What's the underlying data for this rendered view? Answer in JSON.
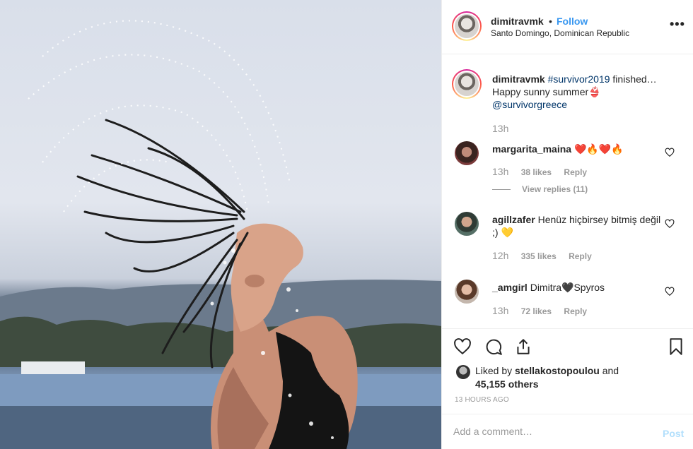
{
  "post": {
    "username": "dimitravmk",
    "follow_label": "Follow",
    "dot": "•",
    "location": "Santo Domingo, Dominican Republic",
    "more": "•••"
  },
  "caption": {
    "username": "dimitravmk",
    "hashtag": "#survivor2019",
    "text1": " finished…",
    "line2": "Happy sunny summer👙",
    "mention": "@survivorgreece",
    "time": "13h"
  },
  "comments": [
    {
      "username": "margarita_maina",
      "text": "❤️🔥❤️🔥",
      "time": "13h",
      "likes": "38 likes",
      "reply": "Reply",
      "view_replies": "View replies (11)"
    },
    {
      "username": "agillzafer",
      "text": "Henüz hiçbirsey bitmiş değil ;) 💛",
      "time": "12h",
      "likes": "335 likes",
      "reply": "Reply"
    },
    {
      "username": "_amgirl",
      "text": "Dimitra🖤Spyros",
      "time": "13h",
      "likes": "72 likes",
      "reply": "Reply"
    }
  ],
  "liked": {
    "prefix": "Liked by ",
    "user": "stellakostopoulou",
    "and": " and",
    "others": "45,155 others"
  },
  "time_ago": "13 HOURS AGO",
  "comment_box": {
    "placeholder": "Add a comment…",
    "post_label": "Post"
  },
  "icons": {
    "like": "heart-icon",
    "comment": "comment-bubble-icon",
    "share": "share-icon",
    "save": "bookmark-icon",
    "more": "more-options-icon"
  }
}
